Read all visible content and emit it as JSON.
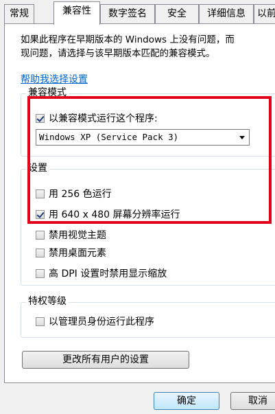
{
  "tabs": [
    {
      "label": "常规"
    },
    {
      "label": "兼容性"
    },
    {
      "label": "数字签名"
    },
    {
      "label": "安全"
    },
    {
      "label": "详细信息"
    },
    {
      "label": "以前"
    }
  ],
  "intro_text_line1": "如果此程序在早期版本的 Windows 上没有问题，而",
  "intro_text_line2": "现问题，请选择与该早期版本匹配的兼容模式。",
  "help_link": "帮助我选择设置",
  "compat_mode": {
    "title": "兼容模式",
    "run_in_compat_label": "以兼容模式运行这个程序:",
    "run_in_compat_checked": true,
    "selected_os": "Windows XP (Service Pack 3)"
  },
  "settings": {
    "title": "设置",
    "items": [
      {
        "label": "用 256 色运行",
        "checked": false
      },
      {
        "label": "用 640 x 480 屏幕分辨率运行",
        "checked": true
      },
      {
        "label": "禁用视觉主题",
        "checked": false
      },
      {
        "label": "禁用桌面元素",
        "checked": false
      },
      {
        "label": "高 DPI 设置时禁用显示缩放",
        "checked": false
      }
    ]
  },
  "privilege": {
    "title": "特权等级",
    "run_as_admin_label": "以管理员身份运行此程序",
    "run_as_admin_checked": false
  },
  "change_all_users_button": "更改所有用户的设置",
  "ok_button": "确定",
  "cancel_button": "取消",
  "colors": {
    "highlight": "#e3001b",
    "link": "#0066cc"
  }
}
